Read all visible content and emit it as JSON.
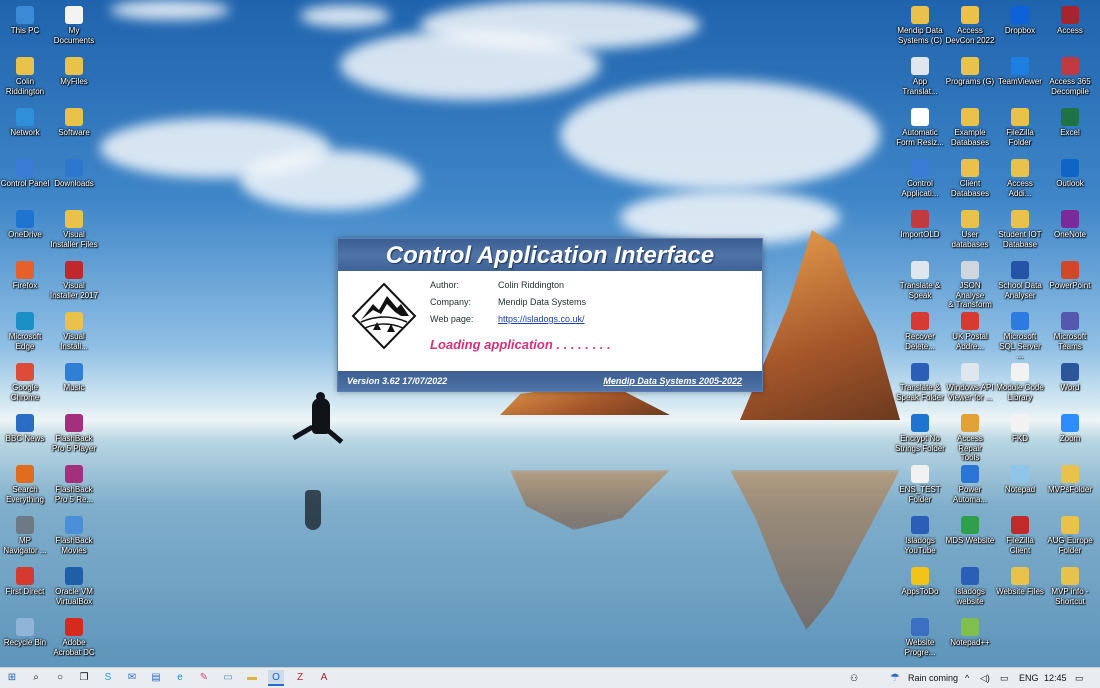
{
  "desktop": {
    "left_icons": [
      {
        "label": "This PC",
        "icon": "monitor-icon",
        "color": "#3a8ad6"
      },
      {
        "label": "My\nDocuments",
        "icon": "document-icon",
        "color": "#f3f3f3"
      },
      {
        "label": "Colin\nRiddington",
        "icon": "user-folder-icon",
        "color": "#e8c24a"
      },
      {
        "label": "MyFiles",
        "icon": "folder-icon",
        "color": "#e8c24a"
      },
      {
        "label": "Network",
        "icon": "network-icon",
        "color": "#2f8fd8"
      },
      {
        "label": "Software",
        "icon": "folder-icon",
        "color": "#e8c24a"
      },
      {
        "label": "Control Panel",
        "icon": "control-panel-icon",
        "color": "#3a7bd5"
      },
      {
        "label": "Downloads",
        "icon": "download-icon",
        "color": "#2e77d0"
      },
      {
        "label": "OneDrive",
        "icon": "cloud-icon",
        "color": "#1e74d0"
      },
      {
        "label": "Visual\nInstaller Files",
        "icon": "folder-icon",
        "color": "#e8c24a"
      },
      {
        "label": "Firefox",
        "icon": "firefox-icon",
        "color": "#e6602b"
      },
      {
        "label": "Visual\nInstaller 2017",
        "icon": "installer-icon",
        "color": "#c0282d"
      },
      {
        "label": "Microsoft\nEdge",
        "icon": "edge-icon",
        "color": "#1b8fc6"
      },
      {
        "label": "Visual\nInstall...",
        "icon": "folder-icon",
        "color": "#e8c24a"
      },
      {
        "label": "Google\nChrome",
        "icon": "chrome-icon",
        "color": "#dd4b39"
      },
      {
        "label": "Music",
        "icon": "music-icon",
        "color": "#2f7fd6"
      },
      {
        "label": "BBC News",
        "icon": "power-icon",
        "color": "#2b6cc4"
      },
      {
        "label": "FlashBack\nPro 5 Player",
        "icon": "flashback-icon",
        "color": "#a2307c"
      },
      {
        "label": "Search\nEverything",
        "icon": "search-icon",
        "color": "#e06d1e"
      },
      {
        "label": "FlashBack\nPro 5 Re...",
        "icon": "flashback-icon",
        "color": "#a2307c"
      },
      {
        "label": "MP\nNavigator ...",
        "icon": "airplane-icon",
        "color": "#6d7a86"
      },
      {
        "label": "FlashBack\nMovies",
        "icon": "movies-icon",
        "color": "#4a90d9"
      },
      {
        "label": "First Direct",
        "icon": "bank-icon",
        "color": "#d43a2f"
      },
      {
        "label": "Oracle VM\nVirtualBox",
        "icon": "virtualbox-icon",
        "color": "#1f5fa8"
      },
      {
        "label": "Recycle Bin",
        "icon": "recycle-bin-icon",
        "color": "#8fb4d8"
      },
      {
        "label": "Adobe\nAcrobat DC",
        "icon": "acrobat-icon",
        "color": "#d52b1e"
      }
    ],
    "right_icons": [
      {
        "label": "Mendip Data\nSystems (C)",
        "icon": "document-icon",
        "color": "#e8c24a"
      },
      {
        "label": "Access\nDevCon 2022",
        "icon": "folder-icon",
        "color": "#e8c24a"
      },
      {
        "label": "Dropbox",
        "icon": "dropbox-icon",
        "color": "#0d62d8"
      },
      {
        "label": "Access",
        "icon": "access-icon",
        "color": "#a4262c"
      },
      {
        "label": "App\nTranslat...",
        "icon": "translate-icon",
        "color": "#dfe6ee"
      },
      {
        "label": "Programs (G)",
        "icon": "folder-icon",
        "color": "#e8c24a"
      },
      {
        "label": "TeamViewer",
        "icon": "teamviewer-icon",
        "color": "#1f7fe0"
      },
      {
        "label": "Access 365\nDecompile",
        "icon": "access-icon",
        "color": "#c13a3f"
      },
      {
        "label": "Automatic\nForm Resiz...",
        "icon": "form-icon",
        "color": "#ffffff"
      },
      {
        "label": "Example\nDatabases",
        "icon": "folder-icon",
        "color": "#e8c24a"
      },
      {
        "label": "FileZilla\nFolder",
        "icon": "folder-icon",
        "color": "#e8c24a"
      },
      {
        "label": "Excel",
        "icon": "excel-icon",
        "color": "#1f7244"
      },
      {
        "label": "Control\nApplicati...",
        "icon": "control-panel-icon",
        "color": "#3a7bd5"
      },
      {
        "label": "Client\nDatabases",
        "icon": "folder-icon",
        "color": "#e8c24a"
      },
      {
        "label": "Access\nAddi...",
        "icon": "folder-icon",
        "color": "#e8c24a"
      },
      {
        "label": "Outlook",
        "icon": "outlook-icon",
        "color": "#0f64c8"
      },
      {
        "label": "ImportOLD",
        "icon": "access-icon",
        "color": "#c13a3f"
      },
      {
        "label": "User\ndatabases",
        "icon": "folder-icon",
        "color": "#e8c24a"
      },
      {
        "label": "Student IOT\nDatabase",
        "icon": "folder-icon",
        "color": "#e8c24a"
      },
      {
        "label": "OneNote",
        "icon": "onenote-icon",
        "color": "#7a2a9b"
      },
      {
        "label": "Translate &\nSpeak",
        "icon": "translate-icon",
        "color": "#dfe6ee"
      },
      {
        "label": "JSON Analyse\n& Transform",
        "icon": "json-icon",
        "color": "#cfd6dd"
      },
      {
        "label": "School Data\nAnalyser",
        "icon": "analyser-icon",
        "color": "#2454a6"
      },
      {
        "label": "PowerPoint",
        "icon": "powerpoint-icon",
        "color": "#d24726"
      },
      {
        "label": "Recover\nDelete...",
        "icon": "recover-icon",
        "color": "#d63a32"
      },
      {
        "label": "UK Postal\nAddre...",
        "icon": "house-icon",
        "color": "#d63a32"
      },
      {
        "label": "Microsoft\nSQL Server ...",
        "icon": "sql-server-icon",
        "color": "#2d7be0"
      },
      {
        "label": "Microsoft\nTeams",
        "icon": "teams-icon",
        "color": "#5558af"
      },
      {
        "label": "Translate &\nSpeak Folder",
        "icon": "terminal-icon",
        "color": "#2b5fb7"
      },
      {
        "label": "Windows API\nViewer for ...",
        "icon": "api-viewer-icon",
        "color": "#dfe6ee"
      },
      {
        "label": "Module Code\nLibrary",
        "icon": "library-icon",
        "color": "#f2f2f2"
      },
      {
        "label": "Word",
        "icon": "word-icon",
        "color": "#2b579a"
      },
      {
        "label": "Encrypt No\nStrings Folder",
        "icon": "help-icon",
        "color": "#1f74d0"
      },
      {
        "label": "Access Repair\nTools",
        "icon": "key-icon",
        "color": "#e2a23a"
      },
      {
        "label": "FKD",
        "icon": "fkd-icon",
        "color": "#f2f2f2"
      },
      {
        "label": "Zoom",
        "icon": "zoom-icon",
        "color": "#2d8cff"
      },
      {
        "label": "ENS_TEST\nFolder",
        "icon": "document-icon",
        "color": "#f2f2f2"
      },
      {
        "label": "Power\nAutoma...",
        "icon": "power-automate-icon",
        "color": "#2a75d4"
      },
      {
        "label": "Notepad",
        "icon": "notepad-icon",
        "color": "#8fc6e8"
      },
      {
        "label": "MVPsFolder",
        "icon": "folder-icon",
        "color": "#e8c24a"
      },
      {
        "label": "Isladogs\nYouTube",
        "icon": "youtube-icon",
        "color": "#2b5fb7"
      },
      {
        "label": "MDS Website",
        "icon": "globe-icon",
        "color": "#2e9e4f"
      },
      {
        "label": "FileZilla\nClient",
        "icon": "filezilla-icon",
        "color": "#bf2a2a"
      },
      {
        "label": "AUG Europe\nFolder",
        "icon": "folder-icon",
        "color": "#e8c24a"
      },
      {
        "label": "AppsToDo",
        "icon": "star-icon",
        "color": "#f2c318"
      },
      {
        "label": "Isladogs\nwebsite",
        "icon": "website-icon",
        "color": "#2b5fb7"
      },
      {
        "label": "Website Files",
        "icon": "folder-icon",
        "color": "#e8c24a"
      },
      {
        "label": "MVP info -\nShortcut",
        "icon": "document-icon",
        "color": "#e8c24a"
      },
      {
        "label": "Website\nProgre...",
        "icon": "progress-icon",
        "color": "#3b6fc4"
      },
      {
        "label": "Notepad++",
        "icon": "notepadpp-icon",
        "color": "#7fbf4d"
      }
    ]
  },
  "splash": {
    "title": "Control Application Interface",
    "author_label": "Author:",
    "author_value": "Colin Riddington",
    "company_label": "Company:",
    "company_value": "Mendip Data Systems",
    "webpage_label": "Web page:",
    "webpage_value": "https://isladogs.co.uk/",
    "loading_text": "Loading application  . . . . . . . .",
    "version_text": "Version 3.62   17/07/2022",
    "copyright_text": "Mendip Data Systems 2005-2022"
  },
  "taskbar": {
    "apps": [
      {
        "name": "start-button",
        "glyph": "⊞",
        "color": "#1f5fb0"
      },
      {
        "name": "search-icon",
        "glyph": "⌕",
        "color": "#111"
      },
      {
        "name": "cortana-icon",
        "glyph": "○",
        "color": "#111"
      },
      {
        "name": "task-view-icon",
        "glyph": "❐",
        "color": "#111"
      },
      {
        "name": "skype-icon",
        "glyph": "S",
        "color": "#1e9ee0"
      },
      {
        "name": "mail-icon",
        "glyph": "✉",
        "color": "#2b6cc4"
      },
      {
        "name": "store-icon",
        "glyph": "▤",
        "color": "#2b6cc4"
      },
      {
        "name": "edge-icon",
        "glyph": "e",
        "color": "#1b8fc6"
      },
      {
        "name": "paint-icon",
        "glyph": "✎",
        "color": "#d04a7a"
      },
      {
        "name": "notepad-icon",
        "glyph": "▭",
        "color": "#5a8fbf"
      },
      {
        "name": "explorer-icon",
        "glyph": "▬",
        "color": "#e1b341"
      },
      {
        "name": "outlook-icon",
        "glyph": "O",
        "color": "#0f64c8"
      },
      {
        "name": "filezilla-icon",
        "glyph": "Z",
        "color": "#bf2a2a"
      },
      {
        "name": "access-icon",
        "glyph": "A",
        "color": "#a4262c"
      }
    ],
    "weather_text": "Rain coming",
    "language": "ENG",
    "time": "12:45"
  }
}
